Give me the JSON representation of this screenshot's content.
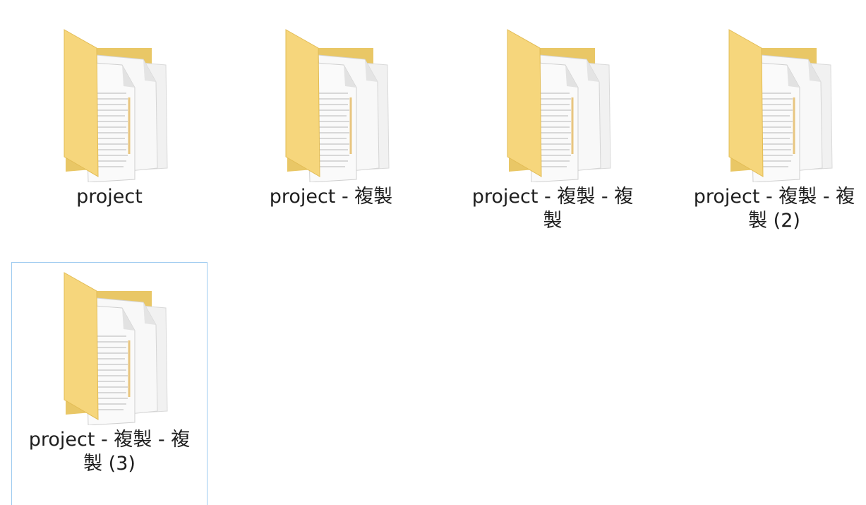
{
  "folder_view": {
    "items": [
      {
        "name": "project",
        "selected": false,
        "icon": "folder-with-documents-icon"
      },
      {
        "name": "project - 複製",
        "selected": false,
        "icon": "folder-with-documents-icon"
      },
      {
        "name": "project - 複製 - 複製",
        "selected": false,
        "icon": "folder-with-documents-icon"
      },
      {
        "name": "project - 複製 - 複製 (2)",
        "selected": false,
        "icon": "folder-with-documents-icon"
      },
      {
        "name": "project - 複製 - 複製 (3)",
        "selected": true,
        "icon": "folder-with-documents-icon"
      }
    ]
  },
  "colors": {
    "folder_front": "#f5d77a",
    "folder_back": "#e8c35a",
    "selection_border": "#9ecbf0",
    "paper": "#f7f7f7"
  }
}
